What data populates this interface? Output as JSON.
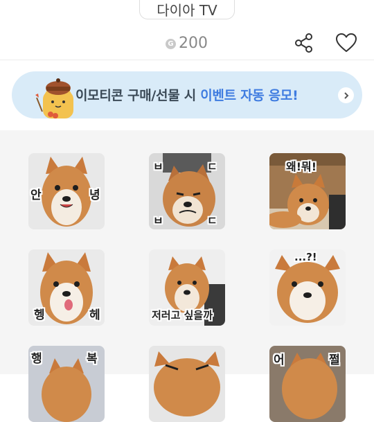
{
  "seller": {
    "name": "다이아 TV"
  },
  "price": {
    "coin_symbol": "G",
    "amount": "200"
  },
  "actions": {
    "share_icon": "share-icon",
    "like_icon": "heart-outline-icon"
  },
  "banner": {
    "text_part1": "이모티콘 구매/선물 시 ",
    "text_part2": "이벤트 자동 응모!",
    "arrow_icon": "chevron-right-circle-icon",
    "character_icon": "cat-with-acorn-hat-icon",
    "colors": {
      "background": "#d9ebf8",
      "accent": "#3f7ce0",
      "text": "#3b4a57"
    }
  },
  "emoticons": [
    {
      "captions": [
        "안",
        "녕"
      ]
    },
    {
      "captions": [
        "ㅂ",
        "ㄷ",
        "ㅂ",
        "ㄷ"
      ]
    },
    {
      "captions": [
        "왜!뭐!"
      ]
    },
    {
      "captions": [
        "헹",
        "헤"
      ]
    },
    {
      "captions": [
        "저러고 싶을까"
      ]
    },
    {
      "captions": [
        "...?!"
      ]
    },
    {
      "captions": [
        "행",
        "복"
      ]
    },
    {
      "captions": []
    },
    {
      "captions": [
        "어",
        "쩔"
      ]
    }
  ]
}
